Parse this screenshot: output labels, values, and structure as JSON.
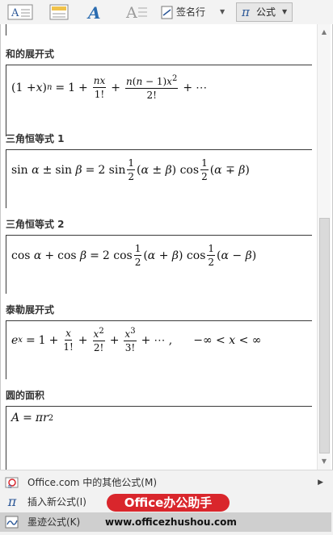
{
  "ribbon": {
    "signature_label": "签名行",
    "formula_label": "公式"
  },
  "gallery": {
    "entries": [
      {
        "title": "和的展开式",
        "formula_text": "(1 + x)^n = 1 + nx/1! + n(n−1)x^2/2! + ⋯"
      },
      {
        "title": "三角恒等式 1",
        "formula_text": "sin α ± sin β = 2 sin 1/2 (α ± β) cos 1/2 (α ∓ β)"
      },
      {
        "title": "三角恒等式 2",
        "formula_text": "cos α + cos β = 2 cos 1/2 (α + β) cos 1/2 (α − β)"
      },
      {
        "title": "泰勒展开式",
        "formula_text": "e^x = 1 + x/1! + x^2/2! + x^3/3! + ⋯ ,   −∞ < x < ∞"
      },
      {
        "title": "圆的面积",
        "formula_text": "A = πr^2"
      }
    ]
  },
  "menu": {
    "more_formulas": "Office.com 中的其他公式(M)",
    "insert_new": "插入新公式(I)",
    "ink_formula": "墨迹公式(K)"
  },
  "watermark": {
    "badge": "Office办公助手",
    "url": "www.officezhushou.com"
  },
  "colors": {
    "accent": "#2b5797",
    "watermark_red": "#d9262c",
    "selected_bg": "#cfcfcf"
  }
}
